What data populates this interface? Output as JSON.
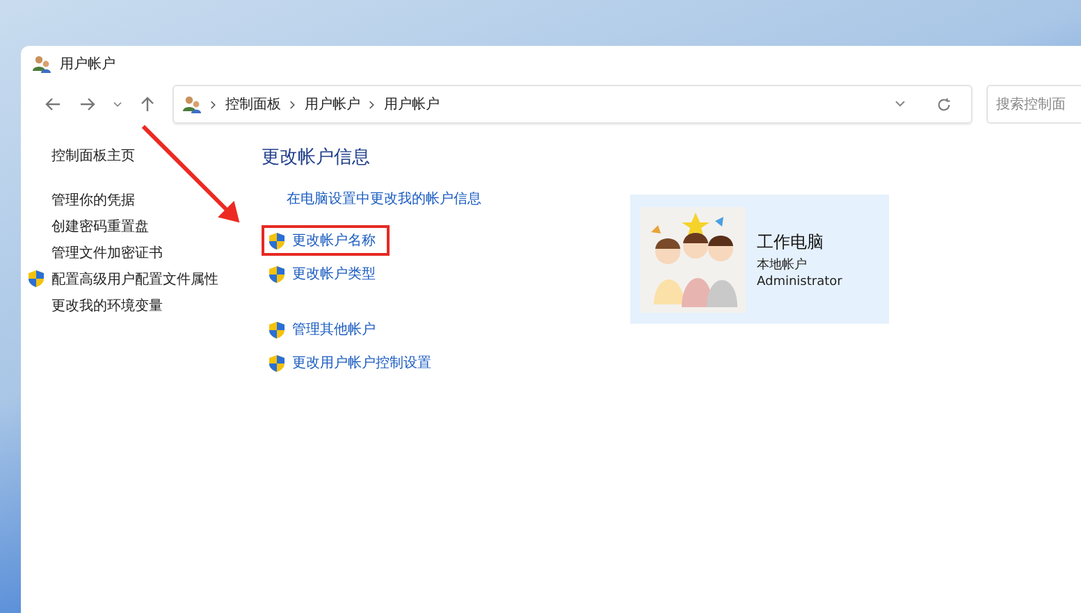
{
  "window": {
    "title": "用户帐户"
  },
  "address_bar": {
    "breadcrumb": [
      "控制面板",
      "用户帐户",
      "用户帐户"
    ]
  },
  "search": {
    "placeholder": "搜索控制面"
  },
  "sidebar": {
    "items": [
      {
        "label": "控制面板主页",
        "shield": false
      },
      {
        "label": "管理你的凭据",
        "shield": false
      },
      {
        "label": "创建密码重置盘",
        "shield": false
      },
      {
        "label": "管理文件加密证书",
        "shield": false
      },
      {
        "label": "配置高级用户配置文件属性",
        "shield": true
      },
      {
        "label": "更改我的环境变量",
        "shield": false
      }
    ]
  },
  "main": {
    "heading": "更改帐户信息",
    "groups": [
      [
        {
          "label": "在电脑设置中更改我的帐户信息",
          "shield": false,
          "highlighted": false
        },
        {
          "label": "更改帐户名称",
          "shield": true,
          "highlighted": true
        },
        {
          "label": "更改帐户类型",
          "shield": true,
          "highlighted": false
        }
      ],
      [
        {
          "label": "管理其他帐户",
          "shield": true,
          "highlighted": false
        },
        {
          "label": "更改用户帐户控制设置",
          "shield": true,
          "highlighted": false
        }
      ]
    ]
  },
  "account": {
    "name": "工作电脑",
    "type": "本地帐户",
    "role": "Administrator"
  }
}
